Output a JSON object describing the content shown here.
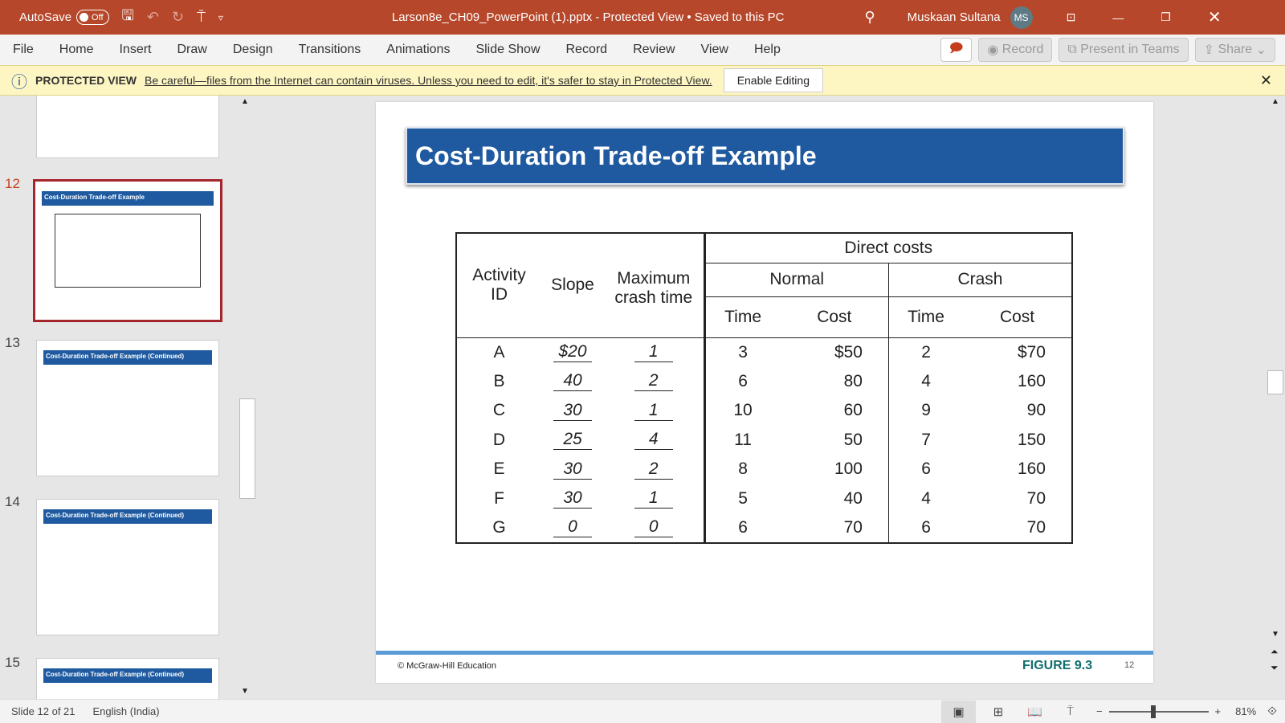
{
  "titlebar": {
    "autosave": "AutoSave",
    "toggle": "Off",
    "title": "Larson8e_CH09_PowerPoint (1).pptx  -  Protected View • Saved to this PC",
    "user": "Muskaan Sultana",
    "initials": "MS"
  },
  "ribbon": {
    "tabs": [
      "File",
      "Home",
      "Insert",
      "Draw",
      "Design",
      "Transitions",
      "Animations",
      "Slide Show",
      "Record",
      "Review",
      "View",
      "Help"
    ],
    "record": "Record",
    "present": "Present in Teams",
    "share": "Share"
  },
  "protected": {
    "label": "PROTECTED VIEW",
    "message": "Be careful—files from the Internet can contain viruses. Unless you need to edit, it's safer to stay in Protected View.",
    "button": "Enable Editing"
  },
  "thumbnails": [
    {
      "num": "12",
      "title": "Cost-Duration Trade-off Example"
    },
    {
      "num": "13",
      "title": "Cost-Duration Trade-off Example (Continued)"
    },
    {
      "num": "14",
      "title": "Cost-Duration Trade-off Example (Continued)"
    },
    {
      "num": "15",
      "title": "Cost-Duration Trade-off Example (Continued)"
    }
  ],
  "slide": {
    "title": "Cost-Duration Trade-off Example",
    "copyright": "© McGraw-Hill Education",
    "figure": "FIGURE 9.3",
    "page": "12",
    "table": {
      "h_activity": "Activity ID",
      "h_slope": "Slope",
      "h_max": "Maximum crash time",
      "h_direct": "Direct costs",
      "h_normal": "Normal",
      "h_crash": "Crash",
      "h_time": "Time",
      "h_cost": "Cost",
      "rows": [
        [
          "A",
          "$20",
          "1",
          "3",
          "$50",
          "2",
          "$70"
        ],
        [
          "B",
          "40",
          "2",
          "6",
          "80",
          "4",
          "160"
        ],
        [
          "C",
          "30",
          "1",
          "10",
          "60",
          "9",
          "90"
        ],
        [
          "D",
          "25",
          "4",
          "11",
          "50",
          "7",
          "150"
        ],
        [
          "E",
          "30",
          "2",
          "8",
          "100",
          "6",
          "160"
        ],
        [
          "F",
          "30",
          "1",
          "5",
          "40",
          "4",
          "70"
        ],
        [
          "G",
          "0",
          "0",
          "6",
          "70",
          "6",
          "70"
        ]
      ]
    }
  },
  "status": {
    "slide": "Slide 12 of 21",
    "language": "English (India)",
    "zoom": "81%"
  }
}
